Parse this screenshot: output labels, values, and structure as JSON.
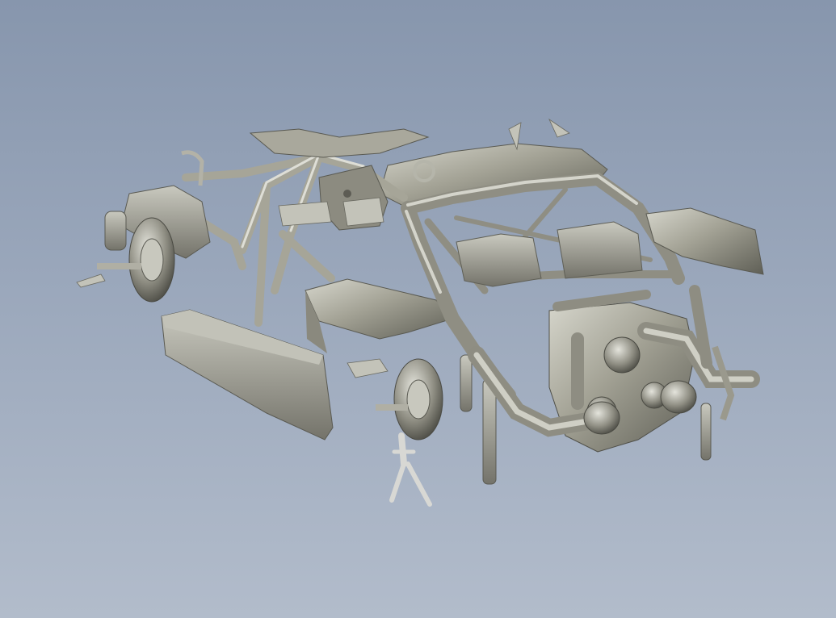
{
  "viewport": {
    "background_top": "#8796ad",
    "background_bottom": "#b2bccb"
  },
  "model": {
    "icon": "car-chassis-scan-icon",
    "surface_color": "#9e9d8f",
    "highlight_color": "#d8d8cf",
    "shadow_color": "#55554d"
  }
}
